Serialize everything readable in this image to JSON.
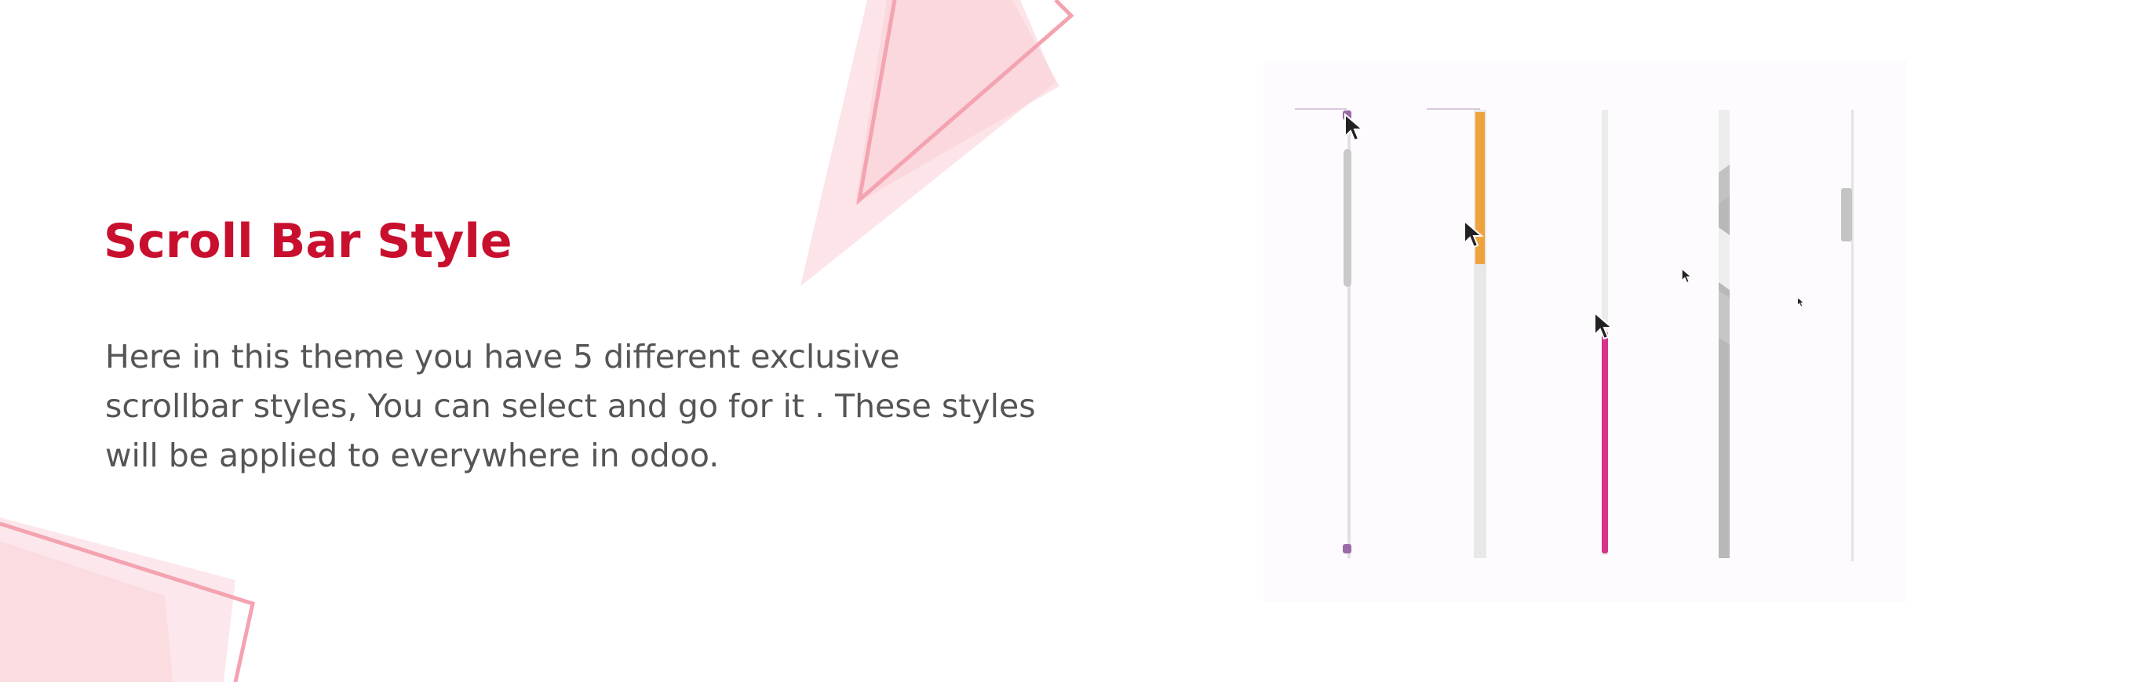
{
  "content": {
    "title": "Scroll Bar Style",
    "description": "Here in this theme you have 5 different exclusive scrollbar styles, You can select and go for it . These styles will be applied to everywhere in odoo."
  },
  "colors": {
    "title": "#c8102e",
    "body_text": "#555555",
    "decor_pink": "#f7c5cd",
    "decor_line": "#f4a3b1",
    "style1_thumb": "#c9c9c9",
    "style1_accent": "#9b6aa8",
    "style2_thumb": "#f0a33c",
    "style3_thumb": "#d6338a",
    "style4_thumb": "#b8b8b8",
    "style5_thumb": "#c4c4c4"
  },
  "scrollbar_styles": [
    {
      "name": "style-1",
      "thumb_fraction": 0.3
    },
    {
      "name": "style-2",
      "thumb_fraction": 0.33
    },
    {
      "name": "style-3",
      "thumb_fraction": 0.5
    },
    {
      "name": "style-4",
      "thumb_fraction": 0.8
    },
    {
      "name": "style-5",
      "thumb_fraction": 0.12
    }
  ]
}
